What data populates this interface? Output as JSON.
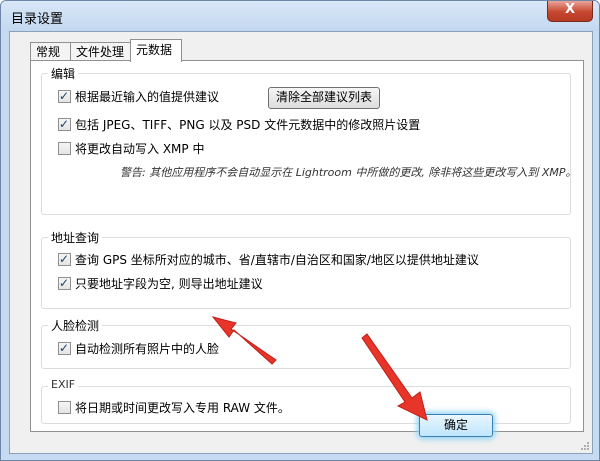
{
  "window": {
    "title": "目录设置",
    "close_label": "X"
  },
  "tabs": [
    {
      "label": "常规",
      "active": false
    },
    {
      "label": "文件处理",
      "active": false
    },
    {
      "label": "元数据",
      "active": true
    }
  ],
  "editing": {
    "legend": "编辑",
    "suggest_label": "根据最近输入的值提供建议",
    "suggest_checked": true,
    "clear_button": "清除全部建议列表",
    "include_dev_label": "包括 JPEG、TIFF、PNG 以及 PSD 文件元数据中的修改照片设置",
    "include_dev_checked": true,
    "auto_xmp_label": "将更改自动写入 XMP 中",
    "auto_xmp_checked": false,
    "warning": "警告: 其他应用程序不会自动显示在 Lightroom 中所做的更改, 除非将这些更改写入到 XMP。"
  },
  "address": {
    "legend": "地址查询",
    "gps_label": "查询 GPS 坐标所对应的城市、省/直辖市/自治区和国家/地区以提供地址建议",
    "gps_checked": true,
    "export_label": "只要地址字段为空, 则导出地址建议",
    "export_checked": true
  },
  "face": {
    "legend": "人脸检测",
    "detect_label": "自动检测所有照片中的人脸",
    "detect_checked": true
  },
  "exif": {
    "legend": "EXIF",
    "raw_label": "将日期或时间更改写入专用 RAW 文件。",
    "raw_checked": false
  },
  "footer": {
    "ok_label": "确定"
  },
  "colors": {
    "arrow": "#e8352a",
    "ok_glow": "#8cd2f6"
  }
}
